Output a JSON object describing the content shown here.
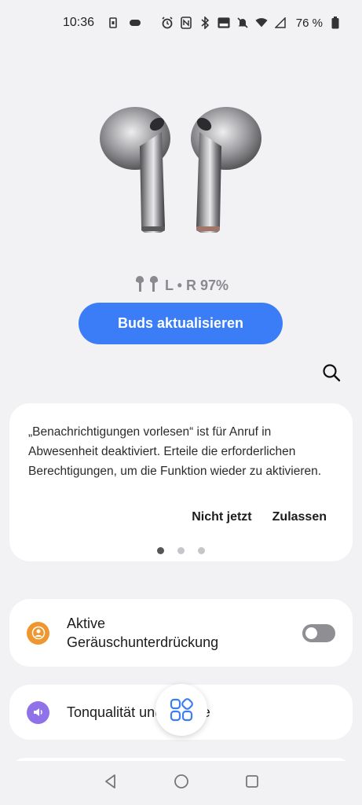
{
  "status_bar": {
    "time": "10:36",
    "battery_percent": "76 %",
    "left_icons": [
      "sim-icon",
      "notification-dot-icon"
    ],
    "right_icons": [
      "alarm-icon",
      "nfc-icon",
      "bluetooth-icon",
      "volte-icon",
      "mute-icon",
      "wifi-icon",
      "signal-icon",
      "battery-icon"
    ]
  },
  "buds": {
    "battery_text": "L • R 97%"
  },
  "update_button": {
    "label": "Buds aktualisieren"
  },
  "notice": {
    "text": "„Benachrichtigungen vorlesen“ ist für Anruf in Abwesenheit deaktiviert. Erteile die erforderlichen Berechtigungen, um die Funktion wieder zu aktivieren.",
    "later_label": "Nicht jetzt",
    "allow_label": "Zulassen",
    "page_count": 3,
    "active_page": 1
  },
  "settings": {
    "anc": {
      "label_line1": "Aktive",
      "label_line2": "Geräuschunterdrückung",
      "enabled": false,
      "icon_color": "#f0962e"
    },
    "sound": {
      "label": "Tonqualität und Effekte",
      "icon_color": "#8f72e8"
    }
  },
  "colors": {
    "accent": "#3b7df6",
    "background": "#f2f2f4"
  }
}
